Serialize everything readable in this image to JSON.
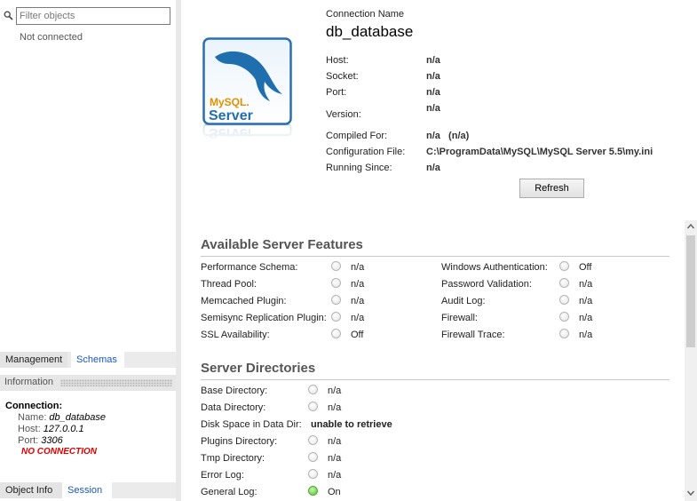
{
  "sidebar": {
    "filter_placeholder": "Filter objects",
    "status": "Not connected",
    "tabs_top": [
      "Management",
      "Schemas"
    ],
    "info_header": "Information",
    "connection": {
      "title": "Connection:",
      "name_label": "Name:",
      "name": "db_database",
      "host_label": "Host:",
      "host": "127.0.0.1",
      "port_label": "Port:",
      "port": "3306",
      "status": "NO CONNECTION"
    },
    "tabs_bottom": [
      "Object Info",
      "Session"
    ]
  },
  "header": {
    "connection_name_label": "Connection Name",
    "connection_name": "db_database",
    "logo_text_1": "MySQL.",
    "logo_text_2": "Server",
    "props": [
      {
        "label": "Host:",
        "value": "n/a"
      },
      {
        "label": "Socket:",
        "value": "n/a"
      },
      {
        "label": "Port:",
        "value": "n/a"
      },
      {
        "label": "Version:",
        "value": "n/a"
      },
      {
        "label": "Compiled For:",
        "value": "n/a   (n/a)"
      },
      {
        "label": "Configuration File:",
        "value": "C:\\ProgramData\\MySQL\\MySQL Server 5.5\\my.ini"
      },
      {
        "label": "Running Since:",
        "value": "n/a"
      }
    ],
    "refresh_label": "Refresh"
  },
  "features": {
    "title": "Available Server Features",
    "left": [
      {
        "label": "Performance Schema:",
        "value": "n/a"
      },
      {
        "label": "Thread Pool:",
        "value": "n/a"
      },
      {
        "label": "Memcached Plugin:",
        "value": "n/a"
      },
      {
        "label": "Semisync Replication Plugin:",
        "value": "n/a"
      },
      {
        "label": "SSL Availability:",
        "value": "Off"
      }
    ],
    "right": [
      {
        "label": "Windows Authentication:",
        "value": "Off"
      },
      {
        "label": "Password Validation:",
        "value": "n/a"
      },
      {
        "label": "Audit Log:",
        "value": "n/a"
      },
      {
        "label": "Firewall:",
        "value": "n/a"
      },
      {
        "label": "Firewall Trace:",
        "value": "n/a"
      }
    ]
  },
  "directories": {
    "title": "Server Directories",
    "items": [
      {
        "label": "Base Directory:",
        "value": "n/a",
        "state": "off"
      },
      {
        "label": "Data Directory:",
        "value": "n/a",
        "state": "off"
      },
      {
        "label": "Disk Space in Data Dir:",
        "value": "unable to retrieve",
        "state": "none"
      },
      {
        "label": "Plugins Directory:",
        "value": "n/a",
        "state": "off"
      },
      {
        "label": "Tmp Directory:",
        "value": "n/a",
        "state": "off"
      },
      {
        "label": "Error Log:",
        "value": "n/a",
        "state": "off"
      },
      {
        "label": "General Log:",
        "value": "On",
        "state": "on"
      }
    ]
  },
  "colors": {
    "link_tab": "#1a56c4",
    "error": "#e00000",
    "radio_on": "#56c234",
    "logo_blue": "#1f6fae"
  }
}
